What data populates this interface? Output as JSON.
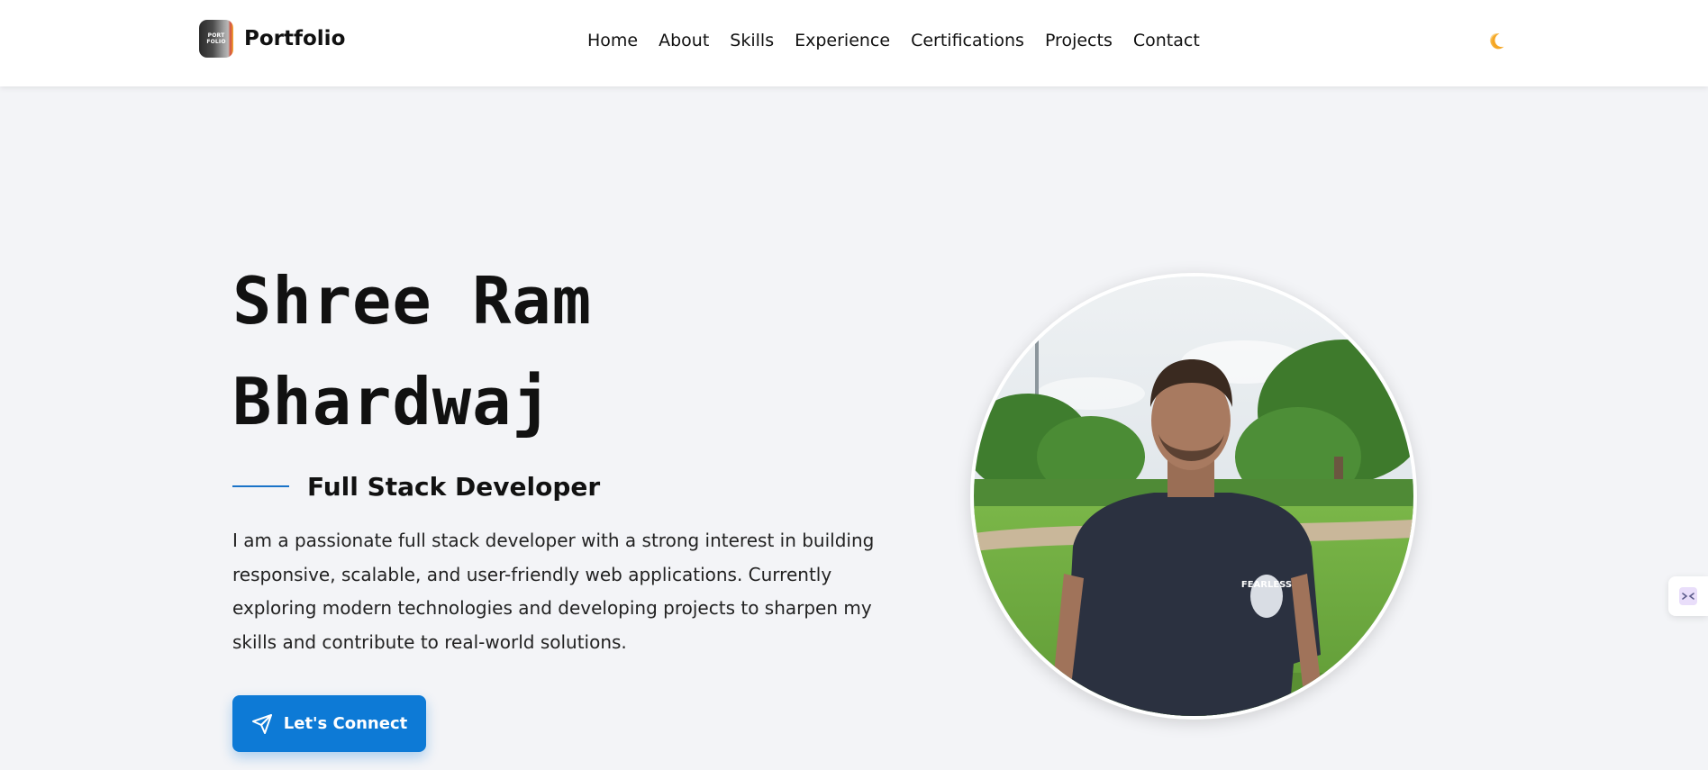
{
  "header": {
    "brand_name": "Portfolio",
    "logo_text_top": "PORT",
    "logo_text_bottom": "FOLIO",
    "nav": [
      "Home",
      "About",
      "Skills",
      "Experience",
      "Certifications",
      "Projects",
      "Contact"
    ],
    "theme_icon": "moon-icon"
  },
  "hero": {
    "name_line1": "Shree Ram",
    "name_line2": "Bhardwaj",
    "role": "Full Stack Developer",
    "bio": "I am a passionate full stack developer with a strong interest in building responsive, scalable, and user-friendly web applications. Currently exploring modern technologies and developing projects to sharpen my skills and contribute to real-world solutions.",
    "cta_label": "Let's Connect",
    "cta_icon": "send-icon",
    "accent_color": "#0d7ad6",
    "shirt_text": "FEARLESS"
  },
  "widget": {
    "icon": "terminal-icon"
  }
}
